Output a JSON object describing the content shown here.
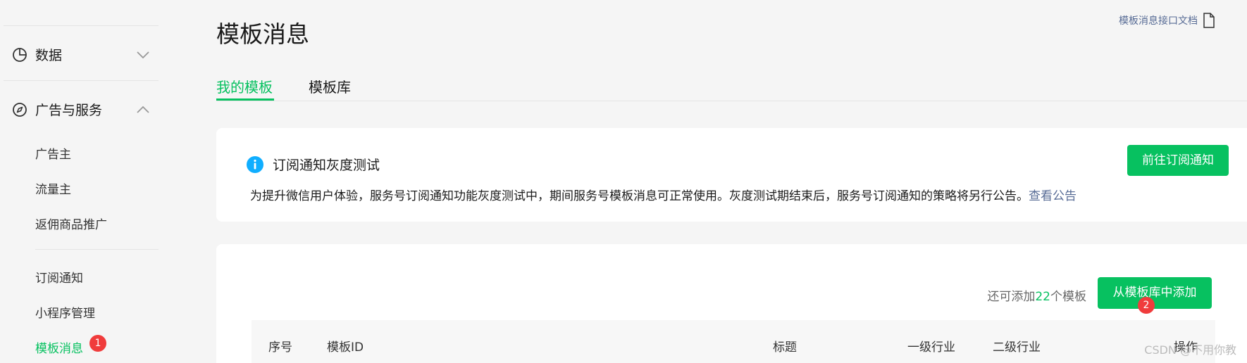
{
  "sidebar": {
    "groups": [
      {
        "label": "数据",
        "icon": "pie-chart-icon",
        "state": "collapsed"
      },
      {
        "label": "广告与服务",
        "icon": "compass-icon",
        "state": "expanded"
      }
    ],
    "items": [
      {
        "label": "广告主"
      },
      {
        "label": "流量主"
      },
      {
        "label": "返佣商品推广"
      },
      {
        "label": "订阅通知"
      },
      {
        "label": "小程序管理"
      },
      {
        "label": "模板消息",
        "active": true,
        "badge": "1"
      }
    ]
  },
  "header": {
    "title": "模板消息",
    "doc_link": "模板消息接口文档",
    "doc_icon": "document-icon"
  },
  "tabs": [
    {
      "label": "我的模板",
      "active": true
    },
    {
      "label": "模板库",
      "active": false
    }
  ],
  "notice": {
    "icon": "info-icon",
    "title": "订阅通知灰度测试",
    "description": "为提升微信用户体验，服务号订阅通知功能灰度测试中，期间服务号模板消息可正常使用。灰度测试期结束后，服务号订阅通知的策略将另行公告。",
    "link": "查看公告",
    "button": "前往订阅通知"
  },
  "templates": {
    "remaining_prefix": "还可添加",
    "remaining_count": "22",
    "remaining_suffix": "个模板",
    "add_button": "从模板库中添加",
    "add_badge": "2",
    "columns": [
      "序号",
      "模板ID",
      "标题",
      "一级行业",
      "二级行业",
      "操作"
    ]
  },
  "watermark": "CSDN @不用你教",
  "colors": {
    "accent": "#07c160",
    "link": "#576b95",
    "badge": "#f03c3c",
    "info": "#10aeff"
  }
}
